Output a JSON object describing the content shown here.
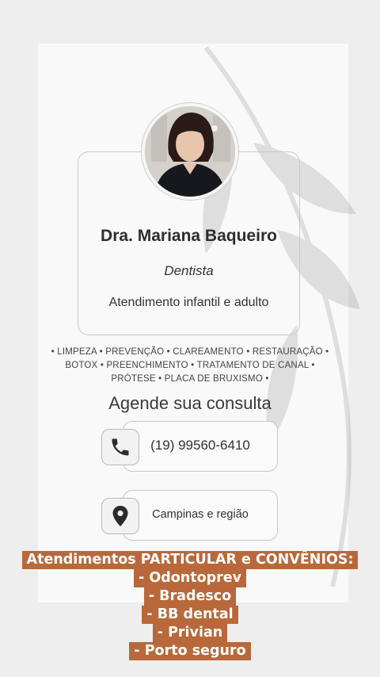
{
  "profile": {
    "name": "Dra. Mariana Baqueiro",
    "role": "Dentista",
    "subtitle": "Atendimento infantil e adulto"
  },
  "services": {
    "line1": "• LIMPEZA • PREVENÇÃO • CLAREAMENTO •  RESTAURAÇÃO •",
    "line2": "BOTOX • PREENCHIMENTO • TRATAMENTO DE CANAL •",
    "line3": "PRÓTESE • PLACA DE BRUXISMO •"
  },
  "cta": "Agende sua consulta",
  "contact": {
    "phone": "(19) 99560-6410",
    "phone_icon": "phone-icon",
    "location": "Campinas e região",
    "location_icon": "map-pin-icon"
  },
  "banner": {
    "title": "Atendimentos PARTICULAR e CONVÊNIOS:",
    "items": [
      "- Odontoprev",
      "- Bradesco",
      "- BB dental",
      "- Privian",
      "- Porto seguro"
    ],
    "color": "#b8683a"
  }
}
